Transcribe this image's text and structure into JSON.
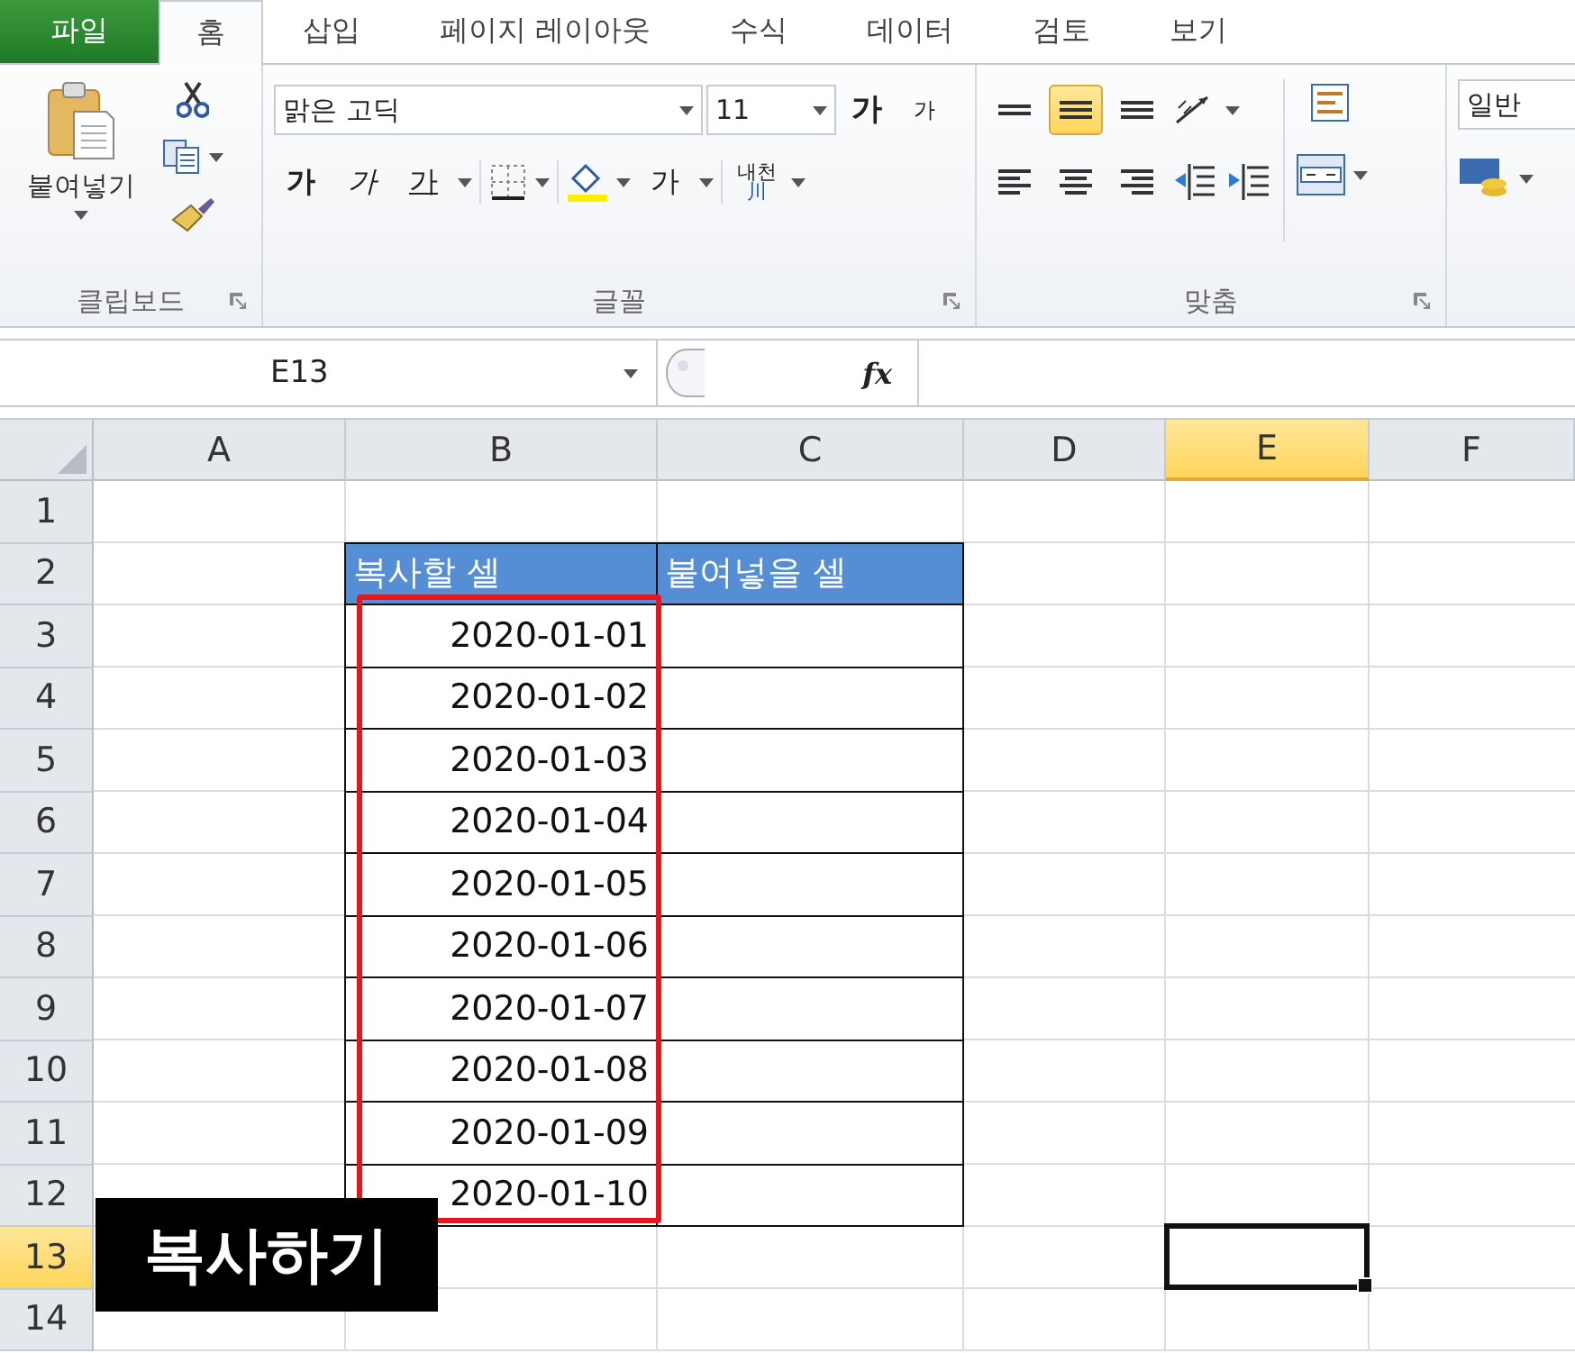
{
  "ribbon_tabs": [
    {
      "label": "파일",
      "kind": "file",
      "selected": false
    },
    {
      "label": "홈",
      "kind": "tab",
      "selected": true
    },
    {
      "label": "삽입",
      "kind": "tab",
      "selected": false
    },
    {
      "label": "페이지 레이아웃",
      "kind": "tab",
      "selected": false
    },
    {
      "label": "수식",
      "kind": "tab",
      "selected": false
    },
    {
      "label": "데이터",
      "kind": "tab",
      "selected": false
    },
    {
      "label": "검토",
      "kind": "tab",
      "selected": false
    },
    {
      "label": "보기",
      "kind": "tab",
      "selected": false
    }
  ],
  "clipboard": {
    "paste_label": "붙여넣기",
    "group_label": "클립보드"
  },
  "font": {
    "font_name": "맑은 고딕",
    "font_size": "11",
    "grow_label": "가",
    "shrink_label": "가",
    "bold_label": "가",
    "italic_label": "가",
    "underline_label": "가",
    "color_label": "가",
    "phonetic_top": "내천",
    "phonetic_bottom": "川",
    "group_label": "글꼴"
  },
  "alignment": {
    "top_row": [
      {
        "kind": "top",
        "selected": false
      },
      {
        "kind": "middle",
        "selected": true
      },
      {
        "kind": "bottom",
        "selected": false
      }
    ],
    "bottom_row": [
      {
        "kind": "left",
        "selected": false
      },
      {
        "kind": "center",
        "selected": false
      },
      {
        "kind": "right",
        "selected": false
      }
    ],
    "group_label": "맞춤"
  },
  "number": {
    "format": "일반"
  },
  "formula_bar": {
    "name_box": "E13",
    "function_label": "fx"
  },
  "columns": [
    {
      "label": "A",
      "selected": false
    },
    {
      "label": "B",
      "selected": false
    },
    {
      "label": "C",
      "selected": false
    },
    {
      "label": "D",
      "selected": false
    },
    {
      "label": "E",
      "selected": true
    },
    {
      "label": "F",
      "selected": false
    }
  ],
  "rows": [
    {
      "label": "1",
      "selected": false
    },
    {
      "label": "2",
      "selected": false
    },
    {
      "label": "3",
      "selected": false
    },
    {
      "label": "4",
      "selected": false
    },
    {
      "label": "5",
      "selected": false
    },
    {
      "label": "6",
      "selected": false
    },
    {
      "label": "7",
      "selected": false
    },
    {
      "label": "8",
      "selected": false
    },
    {
      "label": "9",
      "selected": false
    },
    {
      "label": "10",
      "selected": false
    },
    {
      "label": "11",
      "selected": false
    },
    {
      "label": "12",
      "selected": false
    },
    {
      "label": "13",
      "selected": true
    },
    {
      "label": "14",
      "selected": false
    }
  ],
  "table": {
    "headers": [
      "복사할 셀",
      "붙여넣을 셀"
    ],
    "values": [
      "2020-01-01",
      "2020-01-02",
      "2020-01-03",
      "2020-01-04",
      "2020-01-05",
      "2020-01-06",
      "2020-01-07",
      "2020-01-08",
      "2020-01-09",
      "2020-01-10"
    ]
  },
  "caption": "복사하기"
}
